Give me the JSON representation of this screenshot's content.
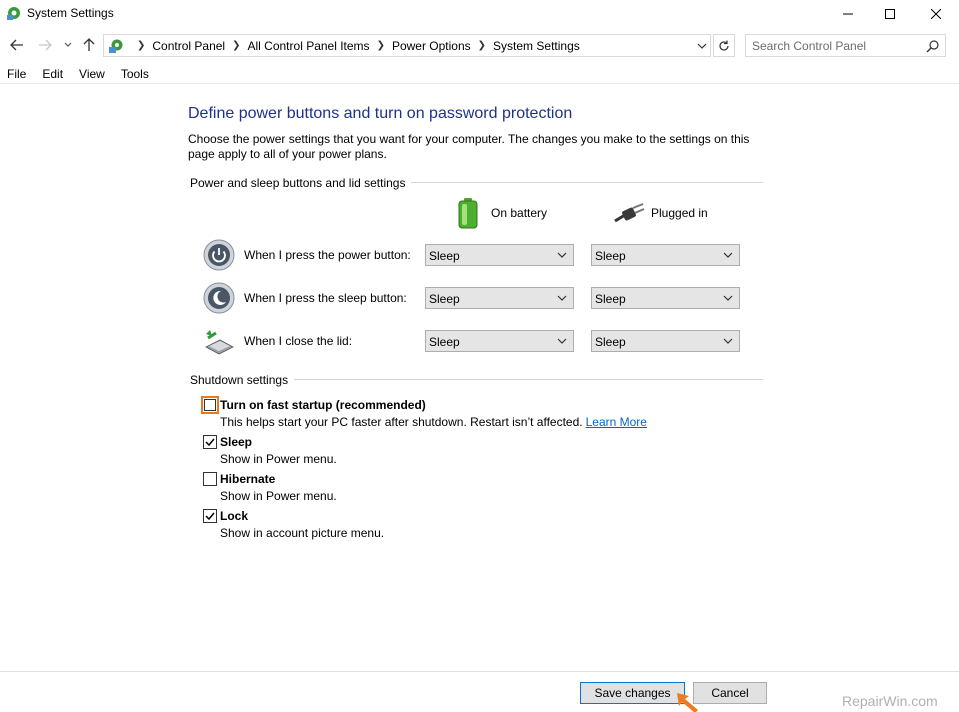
{
  "window": {
    "title": "System Settings"
  },
  "address": {
    "crumbs": [
      "Control Panel",
      "All Control Panel Items",
      "Power Options",
      "System Settings"
    ]
  },
  "search": {
    "placeholder": "Search Control Panel"
  },
  "menu": [
    "File",
    "Edit",
    "View",
    "Tools"
  ],
  "page": {
    "heading": "Define power buttons and turn on password protection",
    "intro": "Choose the power settings that you want for your computer. The changes you make to the settings on this page apply to all of your power plans."
  },
  "power_group": {
    "label": "Power and sleep buttons and lid settings",
    "columns": {
      "battery": "On battery",
      "plugged": "Plugged in"
    },
    "rows": [
      {
        "label": "When I press the power button:",
        "battery": "Sleep",
        "plugged": "Sleep"
      },
      {
        "label": "When I press the sleep button:",
        "battery": "Sleep",
        "plugged": "Sleep"
      },
      {
        "label": "When I close the lid:",
        "battery": "Sleep",
        "plugged": "Sleep"
      }
    ]
  },
  "shutdown_group": {
    "label": "Shutdown settings",
    "options": [
      {
        "title": "Turn on fast startup (recommended)",
        "desc": "This helps start your PC faster after shutdown. Restart isn’t affected.",
        "link": "Learn More",
        "checked": false
      },
      {
        "title": "Sleep",
        "desc": "Show in Power menu.",
        "checked": true
      },
      {
        "title": "Hibernate",
        "desc": "Show in Power menu.",
        "checked": false
      },
      {
        "title": "Lock",
        "desc": "Show in account picture menu.",
        "checked": true
      }
    ]
  },
  "footer": {
    "save": "Save changes",
    "cancel": "Cancel"
  },
  "watermark": "RepairWin.com",
  "colors": {
    "heading": "#1e3287",
    "link": "#0066cc",
    "focus": "#e87a1e",
    "cursor": "#f07a1e"
  }
}
